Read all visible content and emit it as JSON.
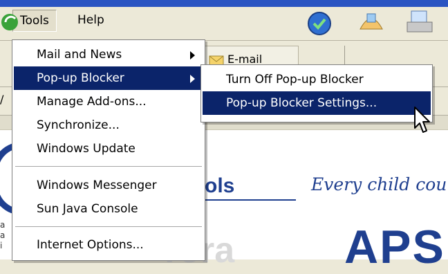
{
  "menubar": {
    "tools": "Tools",
    "help": "Help"
  },
  "tools_menu": {
    "items": [
      {
        "label": "Mail and News",
        "submenu": true
      },
      {
        "label": "Pop-up Blocker",
        "submenu": true,
        "selected": true
      },
      {
        "label": "Manage Add-ons..."
      },
      {
        "label": "Synchronize..."
      },
      {
        "label": "Windows Update"
      },
      {
        "label": "Windows Messenger"
      },
      {
        "label": "Sun Java Console"
      },
      {
        "label": "Internet Options..."
      }
    ]
  },
  "popup_submenu": {
    "items": [
      {
        "label": "Turn Off Pop-up Blocker"
      },
      {
        "label": "Pop-up Blocker Settings...",
        "selected": true
      }
    ]
  },
  "toolbar": {
    "email_partial": "E-mail"
  },
  "page": {
    "brand_fragment": "ols",
    "tagline": "Every child coun",
    "big_letters": "APSI",
    "faded_fragment": "rora",
    "side_text": [
      "a",
      "a",
      "i"
    ]
  },
  "colors": {
    "selection": "#0b246a",
    "brand_blue": "#1f3f8f",
    "chrome": "#ece9d8"
  }
}
